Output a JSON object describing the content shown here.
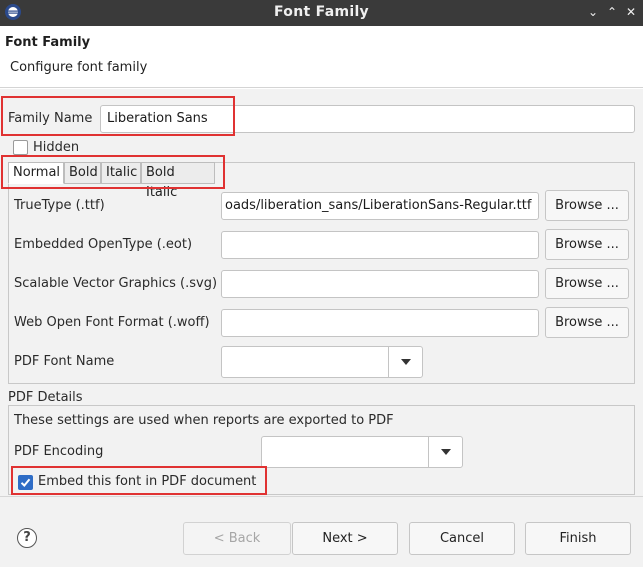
{
  "window": {
    "title": "Font Family",
    "minimize_glyph": "⌄",
    "maximize_glyph": "⌃",
    "close_glyph": "✕"
  },
  "header": {
    "title": "Font Family",
    "subtitle": "Configure font family"
  },
  "family": {
    "label": "Family Name",
    "value": "Liberation Sans",
    "hidden_label": "Hidden",
    "hidden_checked": false
  },
  "tabs": [
    {
      "label": "Normal",
      "active": true
    },
    {
      "label": "Bold",
      "active": false
    },
    {
      "label": "Italic",
      "active": false
    },
    {
      "label": "Bold Italic",
      "active": false
    }
  ],
  "font_files": {
    "truetype_label": "TrueType (.ttf)",
    "truetype_value": "oads/liberation_sans/LiberationSans-Regular.ttf",
    "eot_label": "Embedded OpenType (.eot)",
    "eot_value": "",
    "svg_label": "Scalable Vector Graphics (.svg)",
    "svg_value": "",
    "woff_label": "Web Open Font Format (.woff)",
    "woff_value": "",
    "browse_label": "Browse ...",
    "pdf_font_name_label": "PDF Font Name",
    "pdf_font_name_value": ""
  },
  "pdf_details": {
    "group_label": "PDF Details",
    "description": "These settings are used when reports are exported to PDF",
    "encoding_label": "PDF Encoding",
    "encoding_value": "",
    "embed_label": "Embed this font in PDF document",
    "embed_checked": true
  },
  "footer": {
    "help_glyph": "?",
    "back_label": "< Back",
    "next_label": "Next >",
    "cancel_label": "Cancel",
    "finish_label": "Finish"
  },
  "colors": {
    "titlebar": "#3a3a3a",
    "highlight": "#e03232",
    "checkbox_checked": "#2f6dc6"
  }
}
